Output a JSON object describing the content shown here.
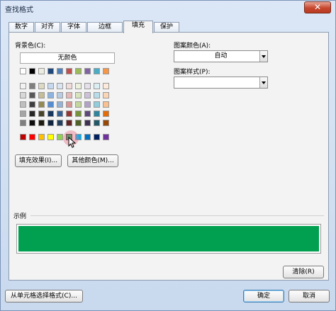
{
  "window": {
    "title": "查找格式",
    "close_glyph": "✕"
  },
  "tabs": [
    {
      "label": "数字",
      "active": false
    },
    {
      "label": "对齐",
      "active": false
    },
    {
      "label": "字体",
      "active": false
    },
    {
      "label": "边框",
      "active": false
    },
    {
      "label": "填充",
      "active": true
    },
    {
      "label": "保护",
      "active": false
    }
  ],
  "fill": {
    "background_label": "背景色(C):",
    "no_color_label": "无颜色",
    "fill_effects_label": "填充效果(I)...",
    "more_colors_label": "其他颜色(M)...",
    "pattern_color_label": "图案颜色(A):",
    "pattern_color_value": "自动",
    "pattern_style_label": "图案样式(P):",
    "pattern_style_value": "",
    "selected_color": "#00a050"
  },
  "palette": {
    "theme_row": [
      "#ffffff",
      "#000000",
      "#eeece1",
      "#1f497d",
      "#4f81bd",
      "#c0504d",
      "#9bbb59",
      "#8064a2",
      "#4bacc6",
      "#f79646"
    ],
    "tint_rows": [
      [
        "#f2f2f2",
        "#7f7f7f",
        "#ddd9c3",
        "#c6d9f0",
        "#dbe5f1",
        "#f2dcdb",
        "#ebf1dd",
        "#e5e0ec",
        "#dbeef3",
        "#fdeada"
      ],
      [
        "#d8d8d8",
        "#595959",
        "#c4bd97",
        "#8db3e2",
        "#b8cce4",
        "#e5b9b7",
        "#d7e3bc",
        "#ccc1d9",
        "#b7dde8",
        "#fbd5b5"
      ],
      [
        "#bfbfbf",
        "#3f3f3f",
        "#938953",
        "#548dd4",
        "#95b3d7",
        "#d99694",
        "#c3d69b",
        "#b2a2c7",
        "#92cddc",
        "#fac08f"
      ],
      [
        "#a5a5a5",
        "#262626",
        "#494429",
        "#17365d",
        "#366092",
        "#953734",
        "#76923c",
        "#5f497a",
        "#31859b",
        "#e36c09"
      ],
      [
        "#7f7f7f",
        "#0c0c0c",
        "#1d1b10",
        "#0f243e",
        "#244061",
        "#632423",
        "#4f6128",
        "#3f3151",
        "#205867",
        "#974806"
      ]
    ],
    "standard_row": [
      "#c00000",
      "#ff0000",
      "#ffc000",
      "#ffff00",
      "#92d050",
      "#00a050",
      "#00b0f0",
      "#0070c0",
      "#002060",
      "#7030a0"
    ],
    "selected_standard_index": 5
  },
  "sample": {
    "label": "示例",
    "color": "#00a050"
  },
  "buttons": {
    "clear_label": "清除(R)",
    "from_cell_label": "从单元格选择格式(C)...",
    "ok_label": "确定",
    "cancel_label": "取消"
  }
}
